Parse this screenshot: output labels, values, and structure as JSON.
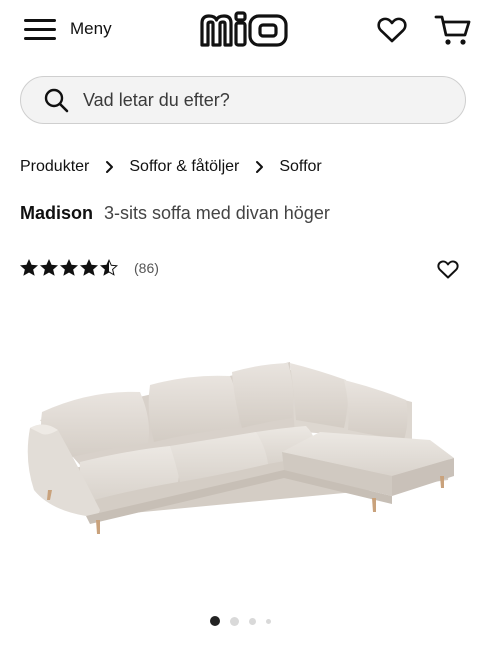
{
  "header": {
    "menu_label": "Meny",
    "logo_text": "mio"
  },
  "search": {
    "placeholder": "Vad letar du efter?"
  },
  "breadcrumb": [
    "Produkter",
    "Soffor & fåtöljer",
    "Soffor"
  ],
  "product": {
    "brand": "Madison",
    "subtitle": "3-sits soffa med divan höger",
    "rating": 4.5,
    "review_count": "(86)"
  },
  "carousel": {
    "slide_count": 4,
    "active_index": 0
  },
  "colors": {
    "text": "#111111",
    "search_bg": "#f3f3f3",
    "dot_active": "#222222",
    "dot_inactive": "#d9d9d9",
    "sofa_fabric": "#e6e1dc"
  },
  "icons": [
    "hamburger-menu-icon",
    "heart-icon",
    "cart-icon",
    "search-icon",
    "chevron-right-icon",
    "star-icon"
  ]
}
